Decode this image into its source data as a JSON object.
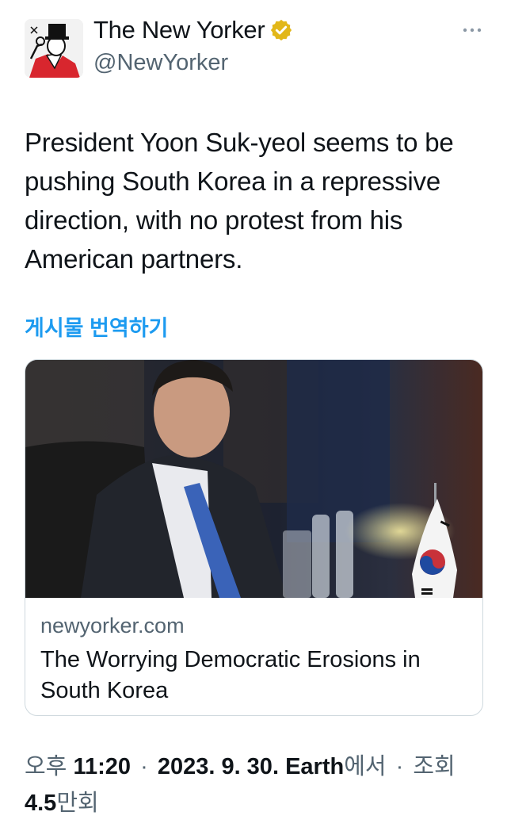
{
  "author": {
    "name": "The New Yorker",
    "handle": "@NewYorker",
    "verified": true,
    "avatar_icon": "eustace-tilley-logo-icon"
  },
  "more_icon": "more-options-icon",
  "tweet": {
    "text": "President Yoon Suk-yeol seems to be pushing South Korea in a repressive direction, with no protest from his American partners.",
    "translate_label": "게시물 번역하기"
  },
  "card": {
    "image_icon": "article-photo",
    "domain": "newyorker.com",
    "title": "The Worrying Democratic Erosions in South Korea"
  },
  "meta": {
    "time_prefix": "오후",
    "time": "11:20",
    "dot": "·",
    "date": "2023. 9. 30.",
    "source": "Earth",
    "source_suffix": "에서",
    "views_prefix": "조회",
    "views_count": "4.5",
    "views_suffix": "만회"
  },
  "colors": {
    "text": "#0f1419",
    "secondary": "#536471",
    "link": "#1d9bf0",
    "verified": "#e2b719",
    "border": "#cfd9de"
  }
}
